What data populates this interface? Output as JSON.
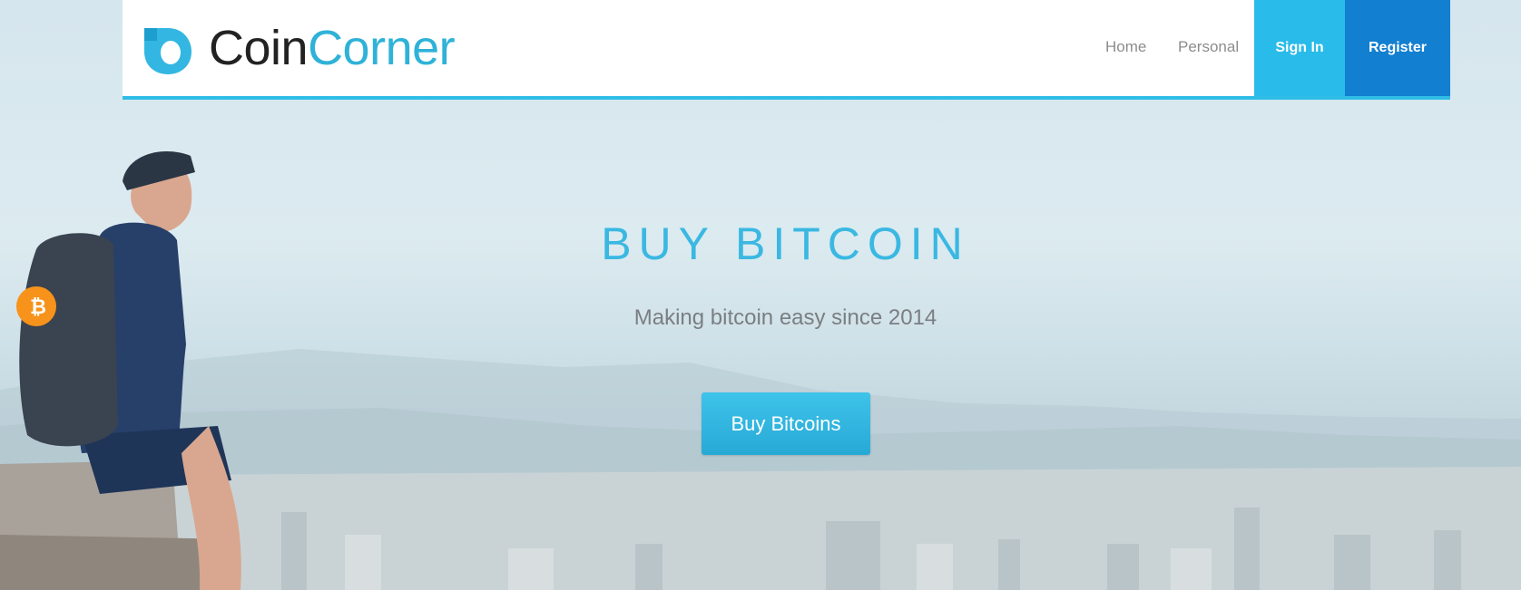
{
  "brand": {
    "name_part1": "Coin",
    "name_part2": "Corner",
    "accent_color": "#2fb2d8",
    "logo_icon": "coincorner-logo-icon"
  },
  "nav": {
    "home": "Home",
    "personal": "Personal",
    "sign_in": "Sign In",
    "register": "Register"
  },
  "hero": {
    "headline": "BUY BITCOIN",
    "tagline": "Making bitcoin easy since 2014",
    "cta": "Buy Bitcoins",
    "background_image": "man-with-bitcoin-backpack-overlooking-city"
  },
  "colors": {
    "header_border": "#2fbde6",
    "sign_in_bg": "#29bbea",
    "register_bg": "#127fd0",
    "cta_bg": "#31b6e0",
    "headline": "#3ab8e2"
  }
}
